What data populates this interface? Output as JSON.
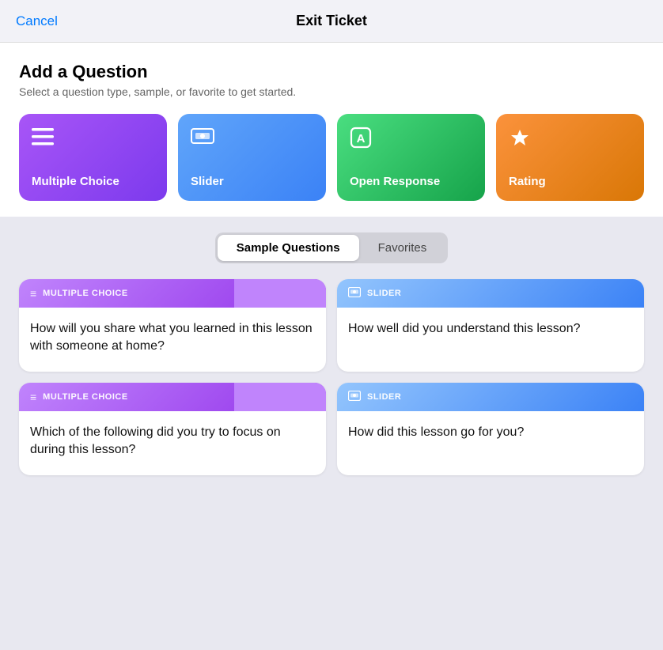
{
  "header": {
    "cancel_label": "Cancel",
    "title": "Exit Ticket"
  },
  "add_question": {
    "title": "Add a Question",
    "subtitle": "Select a question type, sample, or favorite to get started."
  },
  "question_types": [
    {
      "id": "multiple-choice",
      "label": "Multiple Choice",
      "icon": "☰",
      "card_class": "card-purple"
    },
    {
      "id": "slider",
      "label": "Slider",
      "icon": "🖥",
      "card_class": "card-blue"
    },
    {
      "id": "open-response",
      "label": "Open Response",
      "icon": "🅐",
      "card_class": "card-green"
    },
    {
      "id": "rating",
      "label": "Rating",
      "icon": "★",
      "card_class": "card-orange"
    }
  ],
  "tabs": [
    {
      "id": "sample-questions",
      "label": "Sample Questions",
      "active": true
    },
    {
      "id": "favorites",
      "label": "Favorites",
      "active": false
    }
  ],
  "sample_questions": [
    {
      "id": 1,
      "type": "MULTIPLE CHOICE",
      "type_id": "multiple-choice",
      "header_class": "header-purple",
      "icon": "≡",
      "question": "How will you share what you learned in this lesson with someone at home?"
    },
    {
      "id": 2,
      "type": "SLIDER",
      "type_id": "slider",
      "header_class": "header-blue",
      "icon": "▭",
      "question": "How well did you understand this lesson?"
    },
    {
      "id": 3,
      "type": "MULTIPLE CHOICE",
      "type_id": "multiple-choice",
      "header_class": "header-purple",
      "icon": "≡",
      "question": "Which of the following did you try to focus on during this lesson?"
    },
    {
      "id": 4,
      "type": "SLIDER",
      "type_id": "slider",
      "header_class": "header-blue",
      "icon": "▭",
      "question": "How did this lesson go for you?"
    }
  ],
  "colors": {
    "purple": "#9333ea",
    "blue": "#3b82f6",
    "green": "#16a34a",
    "orange": "#d97706",
    "cancel": "#007aff"
  }
}
